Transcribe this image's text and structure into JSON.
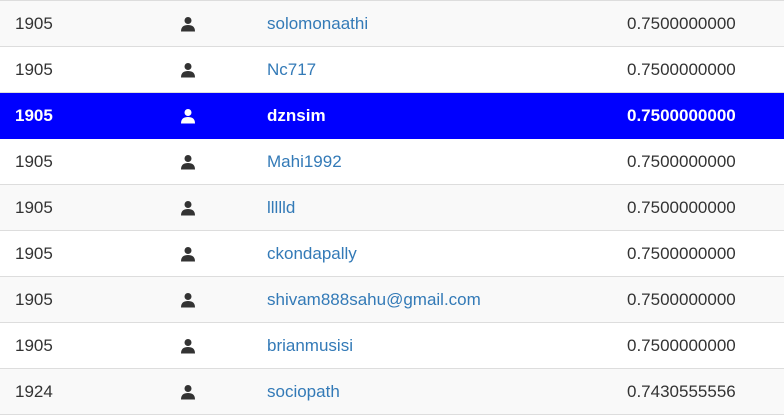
{
  "table": {
    "rows": [
      {
        "rank": "1905",
        "icon": "user-icon",
        "username": "solomonaathi",
        "score": "0.7500000000",
        "selected": false
      },
      {
        "rank": "1905",
        "icon": "user-icon",
        "username": "Nc717",
        "score": "0.7500000000",
        "selected": false
      },
      {
        "rank": "1905",
        "icon": "user-icon",
        "username": "dznsim",
        "score": "0.7500000000",
        "selected": true
      },
      {
        "rank": "1905",
        "icon": "user-icon",
        "username": "Mahi1992",
        "score": "0.7500000000",
        "selected": false
      },
      {
        "rank": "1905",
        "icon": "user-icon",
        "username": "llllld",
        "score": "0.7500000000",
        "selected": false
      },
      {
        "rank": "1905",
        "icon": "user-icon",
        "username": "ckondapally",
        "score": "0.7500000000",
        "selected": false
      },
      {
        "rank": "1905",
        "icon": "user-icon",
        "username": "shivam888sahu@gmail.com",
        "score": "0.7500000000",
        "selected": false
      },
      {
        "rank": "1905",
        "icon": "user-icon",
        "username": "brianmusisi",
        "score": "0.7500000000",
        "selected": false
      },
      {
        "rank": "1924",
        "icon": "user-icon",
        "username": "sociopath",
        "score": "0.7430555556",
        "selected": false
      }
    ]
  },
  "colors": {
    "selected_row": "#0000ff",
    "link": "#337ab7",
    "stripe": "#f9f9f9"
  }
}
